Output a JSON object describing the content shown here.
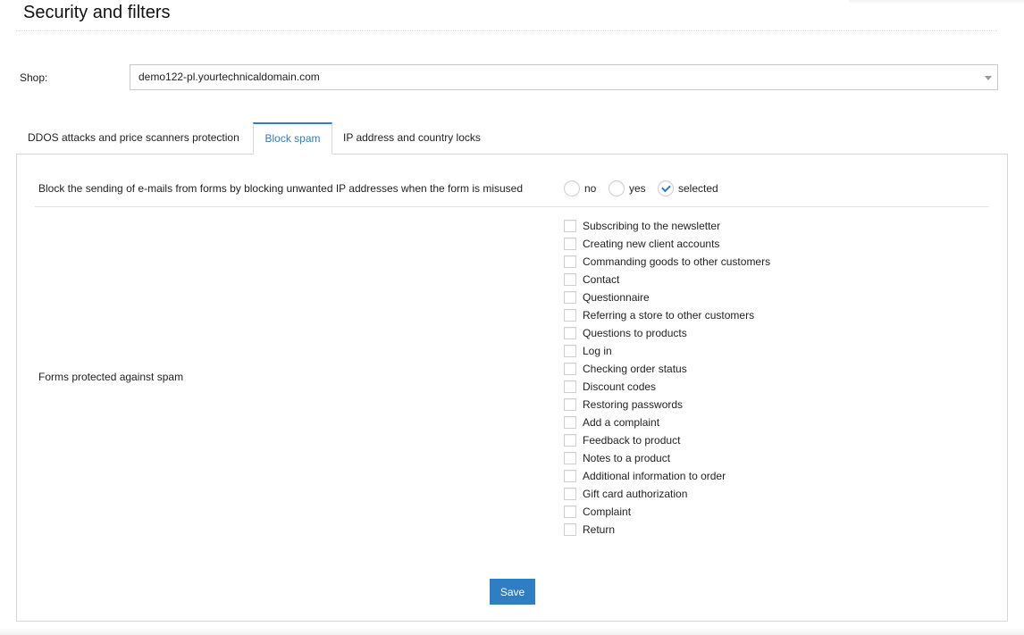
{
  "page": {
    "title": "Security and filters"
  },
  "shop": {
    "label": "Shop:",
    "selected": "demo122-pl.yourtechnicaldomain.com"
  },
  "tabs": [
    {
      "label": "DDOS attacks and price scanners protection",
      "active": false
    },
    {
      "label": "Block spam",
      "active": true
    },
    {
      "label": "IP address and country locks",
      "active": false
    }
  ],
  "block_spam": {
    "block_emails": {
      "label": "Block the sending of e-mails from forms by blocking unwanted IP addresses when the form is misused",
      "options": [
        {
          "label": "no",
          "checked": false
        },
        {
          "label": "yes",
          "checked": false
        },
        {
          "label": "selected",
          "checked": true
        }
      ]
    },
    "forms": {
      "label": "Forms protected against spam",
      "items": [
        {
          "label": "Subscribing to the newsletter",
          "checked": false
        },
        {
          "label": "Creating new client accounts",
          "checked": false
        },
        {
          "label": "Commanding goods to other customers",
          "checked": false
        },
        {
          "label": "Contact",
          "checked": false
        },
        {
          "label": "Questionnaire",
          "checked": false
        },
        {
          "label": "Referring a store to other customers",
          "checked": false
        },
        {
          "label": "Questions to products",
          "checked": false
        },
        {
          "label": "Log in",
          "checked": false
        },
        {
          "label": "Checking order status",
          "checked": false
        },
        {
          "label": "Discount codes",
          "checked": false
        },
        {
          "label": "Restoring passwords",
          "checked": false
        },
        {
          "label": "Add a complaint",
          "checked": false
        },
        {
          "label": "Feedback to product",
          "checked": false
        },
        {
          "label": "Notes to a product",
          "checked": false
        },
        {
          "label": "Additional information to order",
          "checked": false
        },
        {
          "label": "Gift card authorization",
          "checked": false
        },
        {
          "label": "Complaint",
          "checked": false
        },
        {
          "label": "Return",
          "checked": false
        }
      ]
    },
    "save_label": "Save"
  },
  "colors": {
    "accent": "#2f7dc2",
    "border": "#d6d6d6"
  }
}
